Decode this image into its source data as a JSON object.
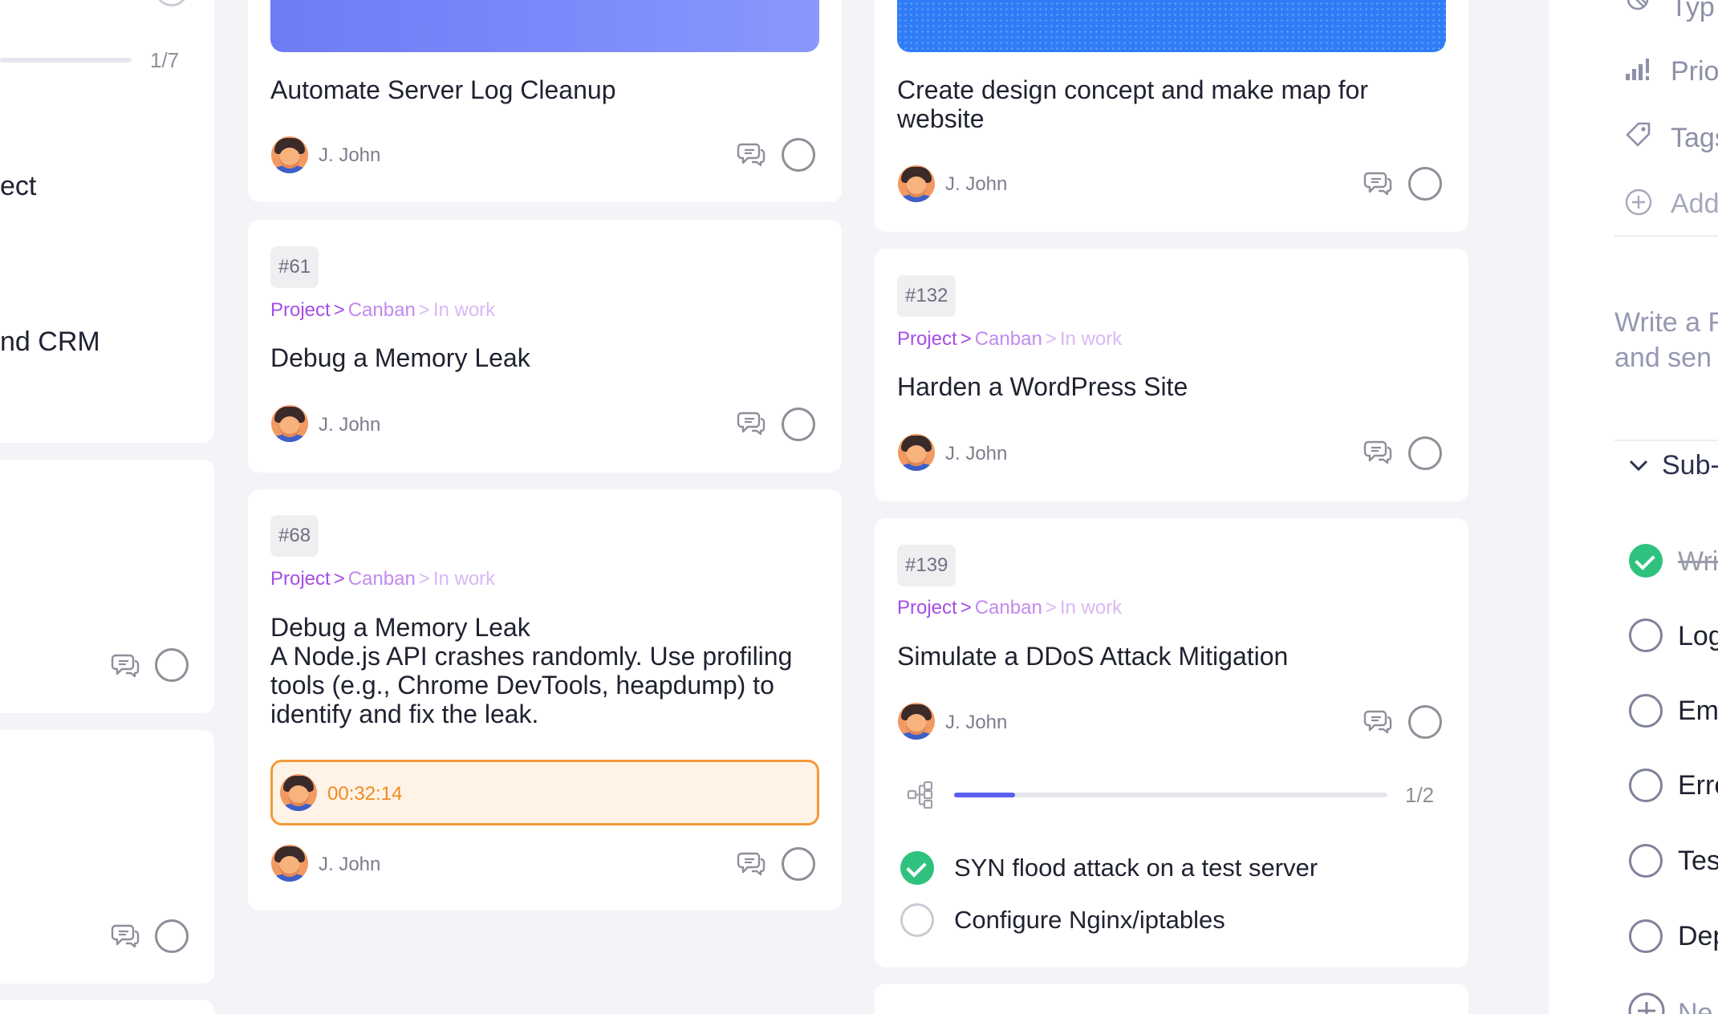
{
  "left_column": {
    "progress_count": "1/7",
    "text_1": "ect",
    "text_2": "nd CRM"
  },
  "cards": [
    {
      "title": "Automate Server Log Cleanup",
      "author": "J. John"
    },
    {
      "id": "#61",
      "breadcrumb": [
        "Project",
        ">",
        "Canban",
        ">",
        "In work"
      ],
      "title": "Debug a Memory Leak",
      "author": "J. John"
    },
    {
      "id": "#68",
      "breadcrumb": [
        "Project",
        ">",
        "Canban",
        ">",
        "In work"
      ],
      "title": "Debug a Memory Leak",
      "description_lines": [
        "A Node.js API crashes randomly. Use profiling",
        "tools (e.g., Chrome DevTools, heapdump) to",
        "identify and fix the leak."
      ],
      "timer": "00:32:14",
      "author": "J. John"
    },
    {
      "title_lines": [
        "Create design concept and make map for",
        "website"
      ],
      "author": "J. John"
    },
    {
      "id": "#132",
      "breadcrumb": [
        "Project",
        ">",
        "Canban",
        ">",
        "In work"
      ],
      "title": "Harden a WordPress Site",
      "author": "J. John"
    },
    {
      "id": "#139",
      "breadcrumb": [
        "Project",
        ">",
        "Canban",
        ">",
        "In work"
      ],
      "title": "Simulate a DDoS Attack Mitigation",
      "author": "J. John",
      "subtasks_progress": 0.14,
      "subtasks_count": "1/2",
      "subtasks": [
        {
          "label": "SYN flood attack on a test server",
          "done": true
        },
        {
          "label": "Configure Nginx/iptables",
          "done": false
        }
      ]
    }
  ],
  "right_panel": {
    "fields": [
      "Typ",
      "Prio",
      "Tags",
      "Add"
    ],
    "write_lines": [
      "Write a F",
      "and sen"
    ],
    "subtasks_header": "Sub-",
    "subtask_items": [
      {
        "label": "Wri",
        "done": true
      },
      {
        "label": "Log",
        "done": false
      },
      {
        "label": "Em",
        "done": false
      },
      {
        "label": "Erre",
        "done": false
      },
      {
        "label": "Tes",
        "done": false
      },
      {
        "label": "Dep",
        "done": false
      },
      {
        "label": "Ne",
        "done": false
      }
    ]
  },
  "colors": {
    "accent": "#5b5ef0",
    "success": "#2ec27e",
    "timer": "#f08a20",
    "breadcrumb": "#a64de6"
  },
  "icons": [
    "comment-icon",
    "subtask-tree-icon",
    "chevron-down-icon",
    "tag-icon",
    "priority-icon",
    "add-icon",
    "type-icon"
  ]
}
